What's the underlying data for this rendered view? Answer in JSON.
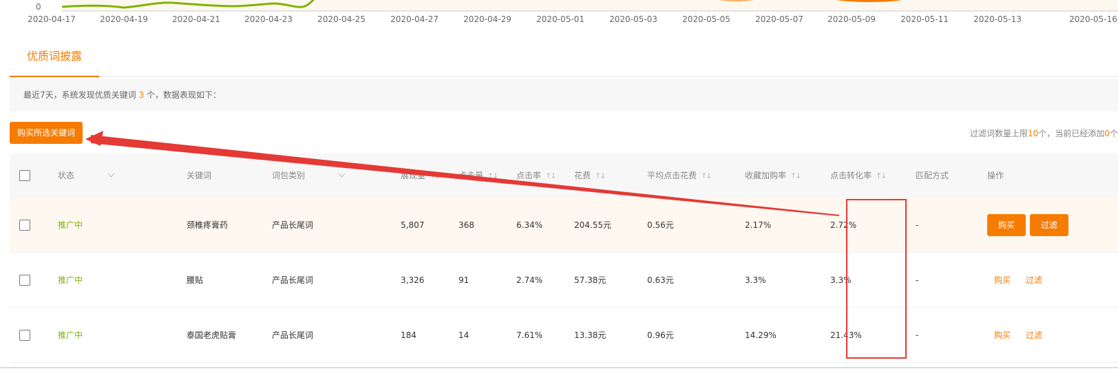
{
  "chart": {
    "y_zero_label": "0",
    "x_ticks": [
      "2020-04-17",
      "2020-04-19",
      "2020-04-21",
      "2020-04-23",
      "2020-04-25",
      "2020-04-27",
      "2020-04-29",
      "2020-05-01",
      "2020-05-03",
      "2020-05-05",
      "2020-05-07",
      "2020-05-09",
      "2020-05-11",
      "2020-05-13",
      "2020-05-16"
    ],
    "line_color": "#7cb305",
    "area_color": "#f57c00",
    "bg_color": "#fdf8ef"
  },
  "tab": {
    "label": "优质词披露"
  },
  "info": {
    "prefix": "最近7天，系统发现优质关键词",
    "count": "3",
    "suffix": "个，数据表现如下："
  },
  "toolbar": {
    "buy_selected_label": "购买所选关键词",
    "limit_prefix": "过滤词数量上限",
    "limit_value": "10",
    "limit_mid": "个，当前已经添加",
    "added_value": "0",
    "limit_suffix": "个"
  },
  "table": {
    "headers": {
      "status": "状态",
      "keyword": "关键词",
      "category": "词包类别",
      "impressions": "展现量",
      "clicks": "点击量",
      "ctr": "点击率",
      "cost": "花费",
      "avg_cpc": "平均点击花费",
      "fav_cart_rate": "收藏加购率",
      "cvr": "点击转化率",
      "match": "匹配方式",
      "actions": "操作"
    },
    "sort_glyph": "↑↓",
    "rows": [
      {
        "status": "推广中",
        "keyword": "颈椎疼膏药",
        "category": "产品长尾词",
        "impressions": "5,807",
        "clicks": "368",
        "ctr": "6.34%",
        "cost": "204.55元",
        "avg_cpc": "0.56元",
        "fav_cart_rate": "2.17%",
        "cvr": "2.72%",
        "match": "-",
        "buy": "购买",
        "filter": "过滤"
      },
      {
        "status": "推广中",
        "keyword": "腰贴",
        "category": "产品长尾词",
        "impressions": "3,326",
        "clicks": "91",
        "ctr": "2.74%",
        "cost": "57.38元",
        "avg_cpc": "0.63元",
        "fav_cart_rate": "3.3%",
        "cvr": "3.3%",
        "match": "-",
        "buy": "购买",
        "filter": "过滤"
      },
      {
        "status": "推广中",
        "keyword": "泰国老虎贴膏",
        "category": "产品长尾词",
        "impressions": "184",
        "clicks": "14",
        "ctr": "7.61%",
        "cost": "13.38元",
        "avg_cpc": "0.96元",
        "fav_cart_rate": "14.29%",
        "cvr": "21.43%",
        "match": "-",
        "buy": "购买",
        "filter": "过滤"
      }
    ]
  },
  "annotation": {
    "color": "#e53935"
  }
}
